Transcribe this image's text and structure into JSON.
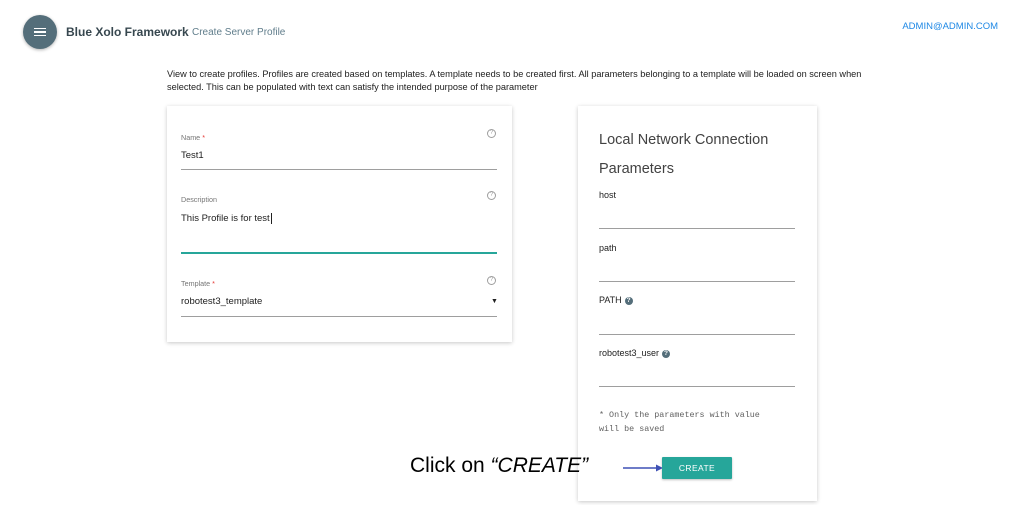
{
  "header": {
    "app_title": "Blue Xolo Framework",
    "page_title": "Create Server Profile",
    "user": "ADMIN@ADMIN.COM"
  },
  "intro": "View to create profiles. Profiles are created based on templates. A template needs to be created first. All parameters belonging to a template will be loaded on screen when selected. This can be populated with text can satisfy the intended purpose of the parameter",
  "form": {
    "name": {
      "label": "Name",
      "required_mark": "*",
      "value": "Test1"
    },
    "description": {
      "label": "Description",
      "value": "This Profile is for test"
    },
    "template": {
      "label": "Template",
      "required_mark": "*",
      "value": "robotest3_template"
    },
    "help_glyph": "?",
    "dropdown_arrow": "▼"
  },
  "connection": {
    "title_line1": "Local Network Connection",
    "title_line2": "Parameters",
    "params": [
      {
        "label": "host",
        "value": ""
      },
      {
        "label": "path",
        "value": ""
      },
      {
        "label": "PATH",
        "value": "",
        "info": "?"
      },
      {
        "label": "robotest3_user",
        "value": "",
        "info": "?"
      }
    ],
    "note_line1": "* Only the parameters with value",
    "note_line2": "will be saved",
    "create_label": "CREATE"
  },
  "callout": {
    "prefix": "Click on ",
    "emphasis": "“CREATE”"
  },
  "colors": {
    "accent": "#26a69a",
    "menu_button": "#546e7a",
    "link": "#1e88e5",
    "required": "#e53935"
  }
}
